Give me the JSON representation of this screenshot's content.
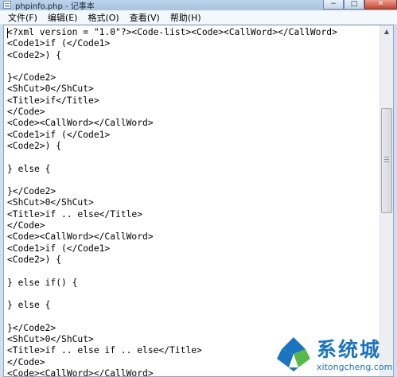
{
  "window": {
    "title": "phpinfo.php - 记事本",
    "controls": {
      "minimize": "−",
      "maximize": "□",
      "close": "✕"
    }
  },
  "menu": {
    "items": [
      "文件(F)",
      "编辑(E)",
      "格式(O)",
      "查看(V)",
      "帮助(H)"
    ]
  },
  "editor": {
    "content": "<?xml version = \"1.0\"?><Code-list><Code><CallWord></CallWord>\n<Code1>if (</Code1>\n<Code2>) {\n\n}</Code2>\n<ShCut>0</ShCut>\n<Title>if</Title>\n</Code>\n<Code><CallWord></CallWord>\n<Code1>if (</Code1>\n<Code2>) {\n\n} else {\n\n}</Code2>\n<ShCut>0</ShCut>\n<Title>if .. else</Title>\n</Code>\n<Code><CallWord></CallWord>\n<Code1>if (</Code1>\n<Code2>) {\n\n} else if() {\n\n} else {\n\n}</Code2>\n<ShCut>0</ShCut>\n<Title>if .. else if .. else</Title>\n</Code>\n<Code><CallWord></CallWord>"
  },
  "scrollbar": {
    "up_arrow": "▲",
    "position_fraction": 0.3
  },
  "watermark": {
    "name": "系统城",
    "domain": "xitongcheng.com",
    "colors": {
      "blue": "#1a74bf",
      "green": "#57b947"
    }
  }
}
